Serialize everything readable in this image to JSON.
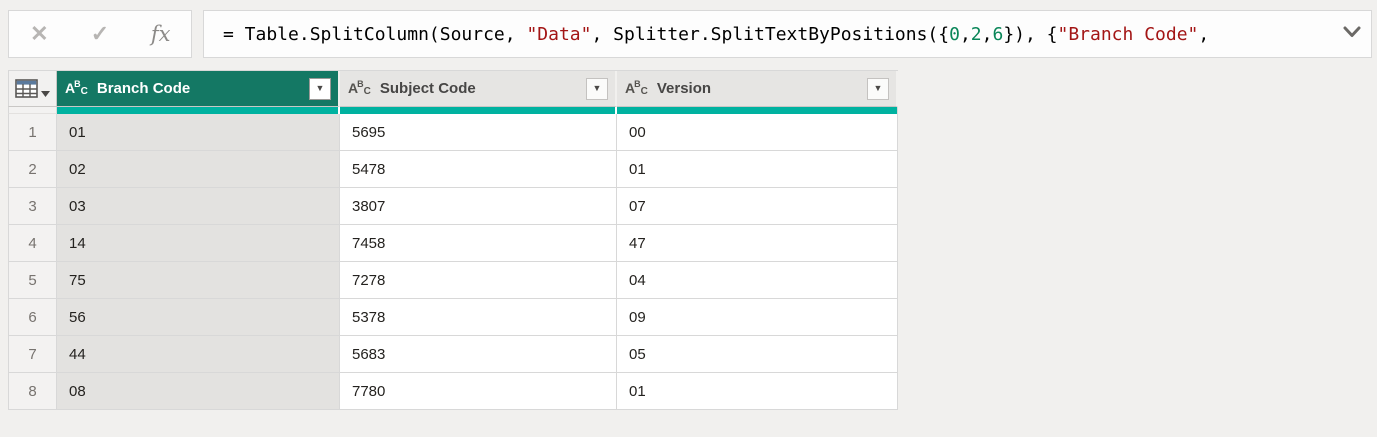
{
  "colors": {
    "accent_teal_quality_bar": "#00b2a0",
    "selected_header_teal": "#147864",
    "formula_string_token": "#a31515",
    "formula_number_token": "#098658",
    "app_background": "#f1f0ee"
  },
  "formula_bar": {
    "cancel_icon": "✕",
    "commit_icon": "✓",
    "fx_icon": "fx",
    "tokens": [
      {
        "type": "plain",
        "text": "= Table.SplitColumn(Source, "
      },
      {
        "type": "string",
        "text": "\"Data\""
      },
      {
        "type": "plain",
        "text": ", Splitter.SplitTextByPositions({"
      },
      {
        "type": "number",
        "text": "0"
      },
      {
        "type": "plain",
        "text": ","
      },
      {
        "type": "number",
        "text": "2"
      },
      {
        "type": "plain",
        "text": ","
      },
      {
        "type": "number",
        "text": "6"
      },
      {
        "type": "plain",
        "text": "}), {"
      },
      {
        "type": "string",
        "text": "\"Branch Code\""
      },
      {
        "type": "plain",
        "text": ","
      }
    ]
  },
  "icons": {
    "abc_a": "A",
    "abc_b": "B",
    "abc_c": "C",
    "filter_dropdown": "▼",
    "corner_caret": "▾"
  },
  "table": {
    "columns": [
      {
        "label": "Branch Code",
        "type": "text",
        "selected": true
      },
      {
        "label": "Subject Code",
        "type": "text",
        "selected": false
      },
      {
        "label": "Version",
        "type": "text",
        "selected": false
      }
    ],
    "rows": [
      {
        "num": "1",
        "cells": [
          "01",
          "5695",
          "00"
        ]
      },
      {
        "num": "2",
        "cells": [
          "02",
          "5478",
          "01"
        ]
      },
      {
        "num": "3",
        "cells": [
          "03",
          "3807",
          "07"
        ]
      },
      {
        "num": "4",
        "cells": [
          "14",
          "7458",
          "47"
        ]
      },
      {
        "num": "5",
        "cells": [
          "75",
          "7278",
          "04"
        ]
      },
      {
        "num": "6",
        "cells": [
          "56",
          "5378",
          "09"
        ]
      },
      {
        "num": "7",
        "cells": [
          "44",
          "5683",
          "05"
        ]
      },
      {
        "num": "8",
        "cells": [
          "08",
          "7780",
          "01"
        ]
      }
    ]
  }
}
